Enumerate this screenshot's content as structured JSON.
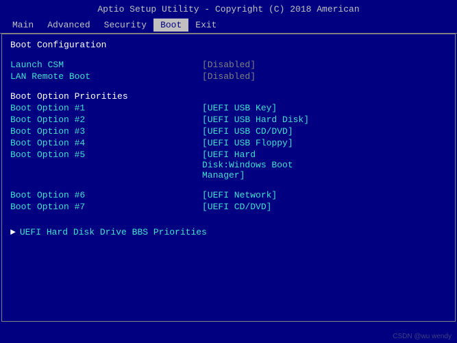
{
  "title": "Aptio Setup Utility - Copyright (C) 2018 American",
  "nav": {
    "items": [
      {
        "label": "Main",
        "active": false
      },
      {
        "label": "Advanced",
        "active": false
      },
      {
        "label": "Security",
        "active": false
      },
      {
        "label": "Boot",
        "active": true
      },
      {
        "label": "Exit",
        "active": false
      }
    ]
  },
  "content": {
    "section": "Boot Configuration",
    "settings": [
      {
        "label": "Launch CSM",
        "value": "[Disabled]"
      },
      {
        "label": "LAN Remote Boot",
        "value": "[Disabled]"
      }
    ],
    "boot_priorities_title": "Boot Option Priorities",
    "boot_options": [
      {
        "label": "Boot Option #1",
        "value": "[UEFI USB Key]"
      },
      {
        "label": "Boot Option #2",
        "value": "[UEFI USB Hard Disk]"
      },
      {
        "label": "Boot Option #3",
        "value": "[UEFI USB CD/DVD]"
      },
      {
        "label": "Boot Option #4",
        "value": "[UEFI USB Floppy]"
      },
      {
        "label": "Boot Option #5",
        "value": "[UEFI Hard\nDisk:Windows Boot\nManager]"
      }
    ],
    "boot_options2": [
      {
        "label": "Boot Option #6",
        "value": "[UEFI Network]"
      },
      {
        "label": "Boot Option #7",
        "value": "[UEFI CD/DVD]"
      }
    ],
    "uefi_link": "UEFI Hard Disk Drive BBS Priorities"
  },
  "watermark": "CSDN @wu wendy"
}
